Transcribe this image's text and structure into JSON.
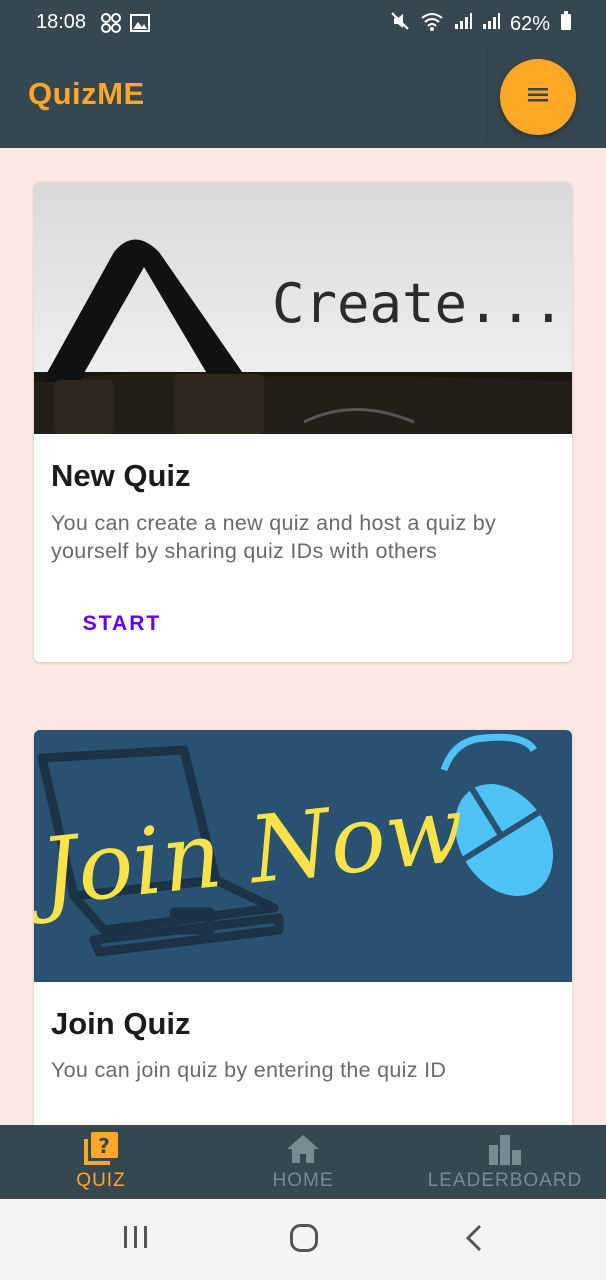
{
  "status_bar": {
    "time": "18:08",
    "battery": "62%",
    "icons": [
      "grid-icon",
      "image-icon",
      "mute-icon",
      "wifi-icon",
      "signal-icon",
      "signal-icon",
      "battery-icon"
    ]
  },
  "app_bar": {
    "title": "QuizME",
    "menu_icon": "menu-icon"
  },
  "cards": [
    {
      "image_text": "Create...",
      "title": "New Quiz",
      "description": "You can create a new quiz and host a quiz by yourself by sharing quiz IDs with others",
      "action_label": "START"
    },
    {
      "image_text": "Join Now",
      "title": "Join Quiz",
      "description": "You can join quiz by entering the quiz ID"
    }
  ],
  "bottom_nav": {
    "items": [
      {
        "label": "QUIZ",
        "icon": "quiz-icon",
        "active": true
      },
      {
        "label": "HOME",
        "icon": "home-icon",
        "active": false
      },
      {
        "label": "LEADERBOARD",
        "icon": "leaderboard-icon",
        "active": false
      }
    ]
  },
  "colors": {
    "primary_dark": "#37474f",
    "accent": "#ffa726",
    "background": "#fde8e4",
    "action": "#6200ee",
    "inactive_nav": "#7a8a91"
  }
}
